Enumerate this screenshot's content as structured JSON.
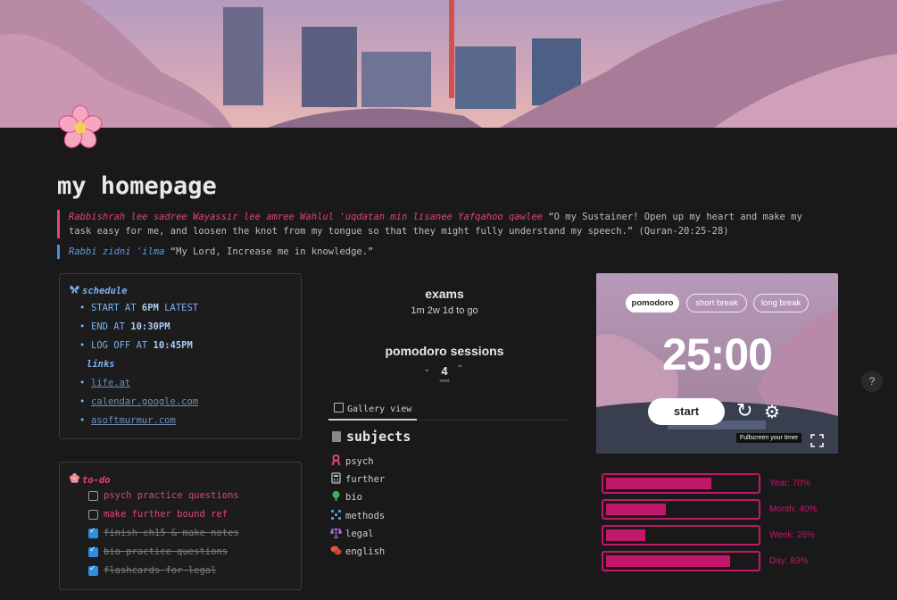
{
  "page": {
    "title": "my homepage",
    "icon": "cherry-blossom-icon"
  },
  "quotes": [
    {
      "arabic": "Rabbishrah lee sadree Wayassir lee amree Wahlul 'uqdatan min lisanee Yafqahoo qawlee",
      "english": "“O my Sustainer! Open up my heart and make my task easy for me, and loosen the knot from my tongue so that they might fully understand my speech.” (Quran-20:25-28)"
    },
    {
      "arabic": "Rabbi zidni 'ilma",
      "english": "“My Lord, Increase me in knowledge.”"
    }
  ],
  "schedule": {
    "heading": "schedule",
    "items": [
      {
        "pre": "START AT ",
        "bold": "6PM",
        "post": " LATEST"
      },
      {
        "pre": "END AT ",
        "bold": "10:30PM",
        "post": ""
      },
      {
        "pre": "LOG OFF AT ",
        "bold": "10:45PM",
        "post": ""
      }
    ],
    "links_heading": "links",
    "links": [
      "life.at",
      "calendar.google.com",
      "asoftmurmur.com"
    ]
  },
  "todo": {
    "heading": "to-do",
    "items": [
      {
        "text": "psych practice questions",
        "done": false
      },
      {
        "text": "make further bound ref",
        "done": false
      },
      {
        "text": "finish ch15 & make notes",
        "done": true
      },
      {
        "text": "bio practice questions",
        "done": true
      },
      {
        "text": "flashcards for legal",
        "done": true
      }
    ]
  },
  "exams": {
    "title": "exams",
    "countdown": "1m 2w 1d to go"
  },
  "pomodoro_sessions": {
    "title": "pomodoro sessions",
    "count": "4",
    "reset": "reset"
  },
  "gallery": {
    "tab_label": "Gallery view",
    "heading": "subjects",
    "items": [
      {
        "label": "psych",
        "icon": "ribbon-icon",
        "color": "#e0457b"
      },
      {
        "label": "further",
        "icon": "calculator-icon",
        "color": "#bdbdbd"
      },
      {
        "label": "bio",
        "icon": "leaf-icon",
        "color": "#3fae5b"
      },
      {
        "label": "methods",
        "icon": "grid-icon",
        "color": "#4a8fe0"
      },
      {
        "label": "legal",
        "icon": "scales-icon",
        "color": "#a06be0"
      },
      {
        "label": "english",
        "icon": "speech-bubble-icon",
        "color": "#e05a3a"
      }
    ]
  },
  "timer": {
    "modes": [
      "pomodoro",
      "short break",
      "long break"
    ],
    "active_mode": "pomodoro",
    "time": "25:00",
    "start_label": "start",
    "fullscreen_tooltip": "Fullscreen your timer"
  },
  "progress": [
    {
      "label": "Year: 70%",
      "value": 0.7
    },
    {
      "label": "Month: 40%",
      "value": 0.4
    },
    {
      "label": "Week: 26%",
      "value": 0.26
    },
    {
      "label": "Day: 83%",
      "value": 0.83
    }
  ],
  "colors": {
    "accent_pink": "#e0457b",
    "accent_blue": "#5b9be6",
    "bar": "#c2186b",
    "background": "#191919"
  },
  "help_label": "?"
}
